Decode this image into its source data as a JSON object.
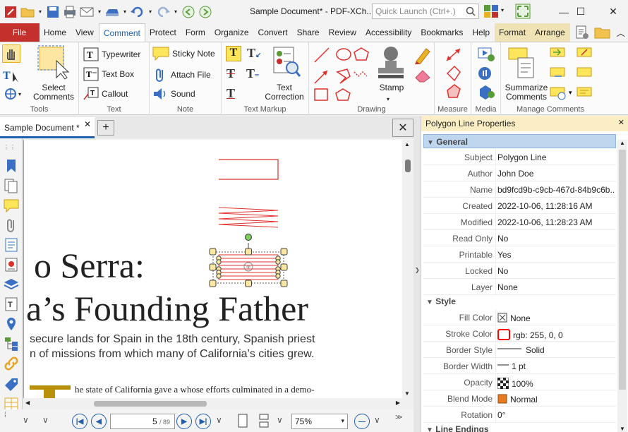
{
  "window": {
    "title": "Sample Document* - PDF-XCh...",
    "quick_launch_placeholder": "Quick Launch (Ctrl+.)",
    "minimize": "—",
    "maximize": "☐",
    "close": "✕"
  },
  "tabs": [
    "File",
    "Home",
    "View",
    "Comment",
    "Protect",
    "Form",
    "Organize",
    "Convert",
    "Share",
    "Review",
    "Accessibility",
    "Bookmarks",
    "Help",
    "Format",
    "Arrange"
  ],
  "ribbon": {
    "tools": {
      "label": "Tools",
      "select_comments": "Select\nComments"
    },
    "text": {
      "label": "Text",
      "typewriter": "Typewriter",
      "text_box": "Text Box",
      "callout": "Callout"
    },
    "note": {
      "label": "Note",
      "sticky_note": "Sticky Note",
      "attach_file": "Attach File",
      "sound": "Sound"
    },
    "text_markup": {
      "label": "Text Markup",
      "text_correction": "Text\nCorrection"
    },
    "drawing": {
      "label": "Drawing",
      "stamp": "Stamp"
    },
    "measure": {
      "label": "Measure"
    },
    "media": {
      "label": "Media"
    },
    "manage": {
      "label": "Manage Comments",
      "summarize": "Summarize\nComments"
    }
  },
  "document": {
    "tab_name": "Sample Document *",
    "heading_line1": "o Serra:",
    "heading_line2": "a’s Founding Father",
    "sub_line1": "secure lands for Spain in the 18th century, Spanish priest",
    "sub_line2": "n of missions from which many of California’s cities grew.",
    "body_line": "he state of California gave a    whose efforts culminated in a demo-"
  },
  "nav": {
    "page": "5",
    "page_total": "/ 89",
    "zoom": "75%"
  },
  "panel": {
    "title": "Polygon Line Properties",
    "general_label": "General",
    "style_label": "Style",
    "line_endings_label": "Line Endings",
    "general": [
      {
        "k": "Subject",
        "v": "Polygon Line"
      },
      {
        "k": "Author",
        "v": "John Doe"
      },
      {
        "k": "Name",
        "v": "bd9fcd9b-c9cb-467d-84b9c6b.."
      },
      {
        "k": "Created",
        "v": "2022-10-06, 11:28:16 AM"
      },
      {
        "k": "Modified",
        "v": "2022-10-06, 11:28:23 AM"
      },
      {
        "k": "Read Only",
        "v": "No"
      },
      {
        "k": "Printable",
        "v": "Yes"
      },
      {
        "k": "Locked",
        "v": "No"
      },
      {
        "k": "Layer",
        "v": "None"
      }
    ],
    "style": [
      {
        "k": "Fill Color",
        "v": "None"
      },
      {
        "k": "Stroke Color",
        "v": "rgb: 255, 0, 0"
      },
      {
        "k": "Border Style",
        "v": "Solid"
      },
      {
        "k": "Border Width",
        "v": "1 pt"
      },
      {
        "k": "Opacity",
        "v": "100%"
      },
      {
        "k": "Blend Mode",
        "v": "Normal"
      },
      {
        "k": "Rotation",
        "v": "0°"
      }
    ]
  },
  "colors": {
    "file_tab": "#c4302b",
    "accent": "#1f5fae",
    "stroke": "#ff0000",
    "context_tab": "#efe2b4",
    "panel_title": "#fbeec5"
  }
}
